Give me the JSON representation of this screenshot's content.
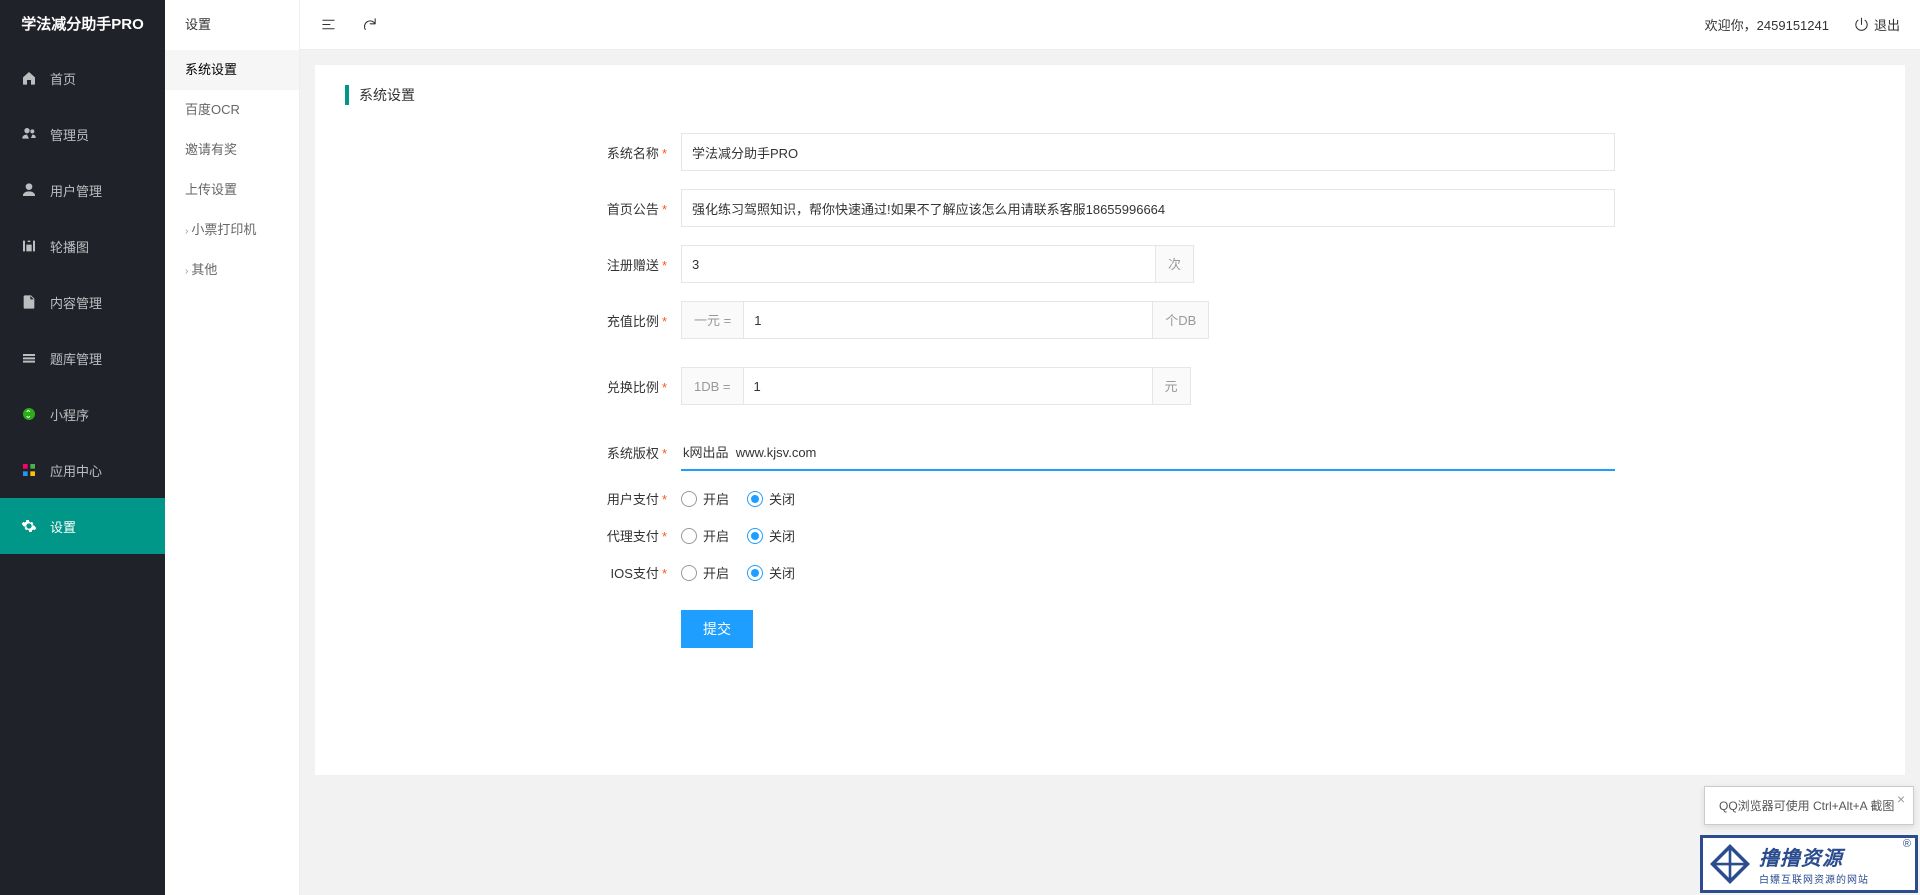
{
  "app_name": "学法减分助手PRO",
  "header": {
    "welcome_prefix": "欢迎你，",
    "username": "2459151241",
    "logout": "退出"
  },
  "sidebar": {
    "items": [
      {
        "label": "首页",
        "icon": "home"
      },
      {
        "label": "管理员",
        "icon": "admin"
      },
      {
        "label": "用户管理",
        "icon": "user"
      },
      {
        "label": "轮播图",
        "icon": "carousel"
      },
      {
        "label": "内容管理",
        "icon": "content"
      },
      {
        "label": "题库管理",
        "icon": "question"
      },
      {
        "label": "小程序",
        "icon": "miniapp"
      },
      {
        "label": "应用中心",
        "icon": "apps"
      },
      {
        "label": "设置",
        "icon": "gear",
        "active": true
      }
    ]
  },
  "subsidebar": {
    "title": "设置",
    "items": [
      {
        "label": "系统设置",
        "active": true
      },
      {
        "label": "百度OCR"
      },
      {
        "label": "邀请有奖"
      },
      {
        "label": "上传设置"
      },
      {
        "label": "小票打印机",
        "expandable": true
      },
      {
        "label": "其他",
        "expandable": true
      }
    ]
  },
  "panel": {
    "title": "系统设置",
    "labels": {
      "system_name": "系统名称",
      "home_notice": "首页公告",
      "register_gift": "注册赠送",
      "recharge_ratio": "充值比例",
      "exchange_ratio": "兑换比例",
      "copyright": "系统版权",
      "user_pay": "用户支付",
      "agent_pay": "代理支付",
      "ios_pay": "IOS支付"
    },
    "values": {
      "system_name": "学法减分助手PRO",
      "home_notice": "强化练习驾照知识，帮你快速通过!如果不了解应该怎么用请联系客服18655996664",
      "register_gift": "3",
      "register_gift_unit": "次",
      "recharge_prefix": "一元 =",
      "recharge_value": "1",
      "recharge_unit": "个DB",
      "exchange_prefix": "1DB =",
      "exchange_value": "1",
      "exchange_unit": "元",
      "copyright": "k网出品  www.kjsv.com"
    },
    "radio": {
      "on": "开启",
      "off": "关闭",
      "user_pay": "off",
      "agent_pay": "off",
      "ios_pay": "off"
    },
    "submit": "提交"
  },
  "toast": {
    "text": "QQ浏览器可使用 Ctrl+Alt+A 截图"
  },
  "watermark": {
    "big": "撸撸资源",
    "small": "白嫖互联网资源的网站",
    "r": "®"
  }
}
